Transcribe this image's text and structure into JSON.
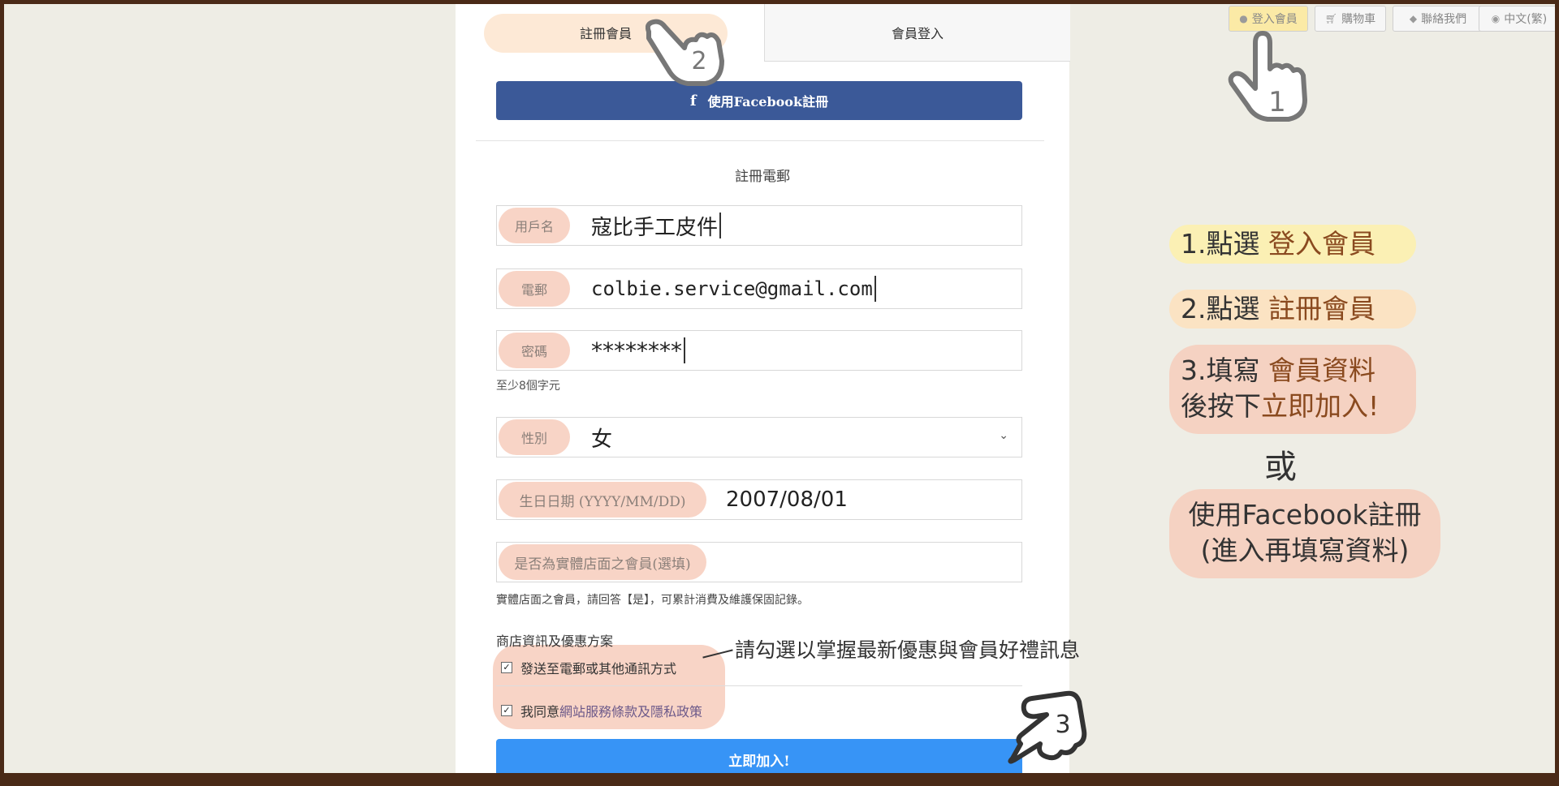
{
  "tabs": {
    "register": "註冊會員",
    "login": "會員登入"
  },
  "facebook": {
    "icon": "f",
    "label": "使用Facebook註冊"
  },
  "section_title": "註冊電郵",
  "fields": {
    "username": {
      "label": "用戶名",
      "value": "寇比手工皮件"
    },
    "email": {
      "label": "電郵",
      "value": "colbie.service@gmail.com"
    },
    "password": {
      "label": "密碼",
      "value": "********",
      "hint": "至少8個字元"
    },
    "gender": {
      "label": "性別",
      "value": "女"
    },
    "birthday": {
      "label": "生日日期 (YYYY/MM/DD)",
      "value": "2007/08/01"
    },
    "store_member": {
      "label": "是否為實體店面之會員(選填)",
      "hint": "實體店面之會員，請回答【是】，可累計消費及維護保固記錄。"
    }
  },
  "preferences": {
    "title": "商店資訊及優惠方案",
    "option_1": "發送至電郵或其他通訊方式",
    "option_2_prefix": "我同意",
    "option_2_link": "網站服務條款及隱私政策",
    "checked_mark": "✓"
  },
  "submit_label": "立即加入!",
  "annotation": "請勾選以掌握最新優惠與會員好禮訊息",
  "nav": {
    "login": "登入會員",
    "cart": "購物車",
    "contact": "聯絡我們",
    "language": "中文(繁)",
    "icons": [
      "user-icon",
      "cart-icon",
      "chat-icon",
      "globe-icon"
    ]
  },
  "steps": {
    "s1_prefix": "1.點選 ",
    "s1_accent": "登入會員",
    "s2_prefix": "2.點選 ",
    "s2_accent": "註冊會員",
    "s3_line1_prefix": "3.填寫 ",
    "s3_line1_accent": "會員資料",
    "s3_line2_prefix": "後按下",
    "s3_line2_accent": "立即加入!",
    "or": "或",
    "s4_line1": "使用Facebook註冊",
    "s4_line2": "(進入再填寫資料)"
  },
  "hand_numbers": [
    "1",
    "2",
    "3"
  ],
  "colors": {
    "facebook_blue": "#3b5998",
    "submit_blue": "#3794f6",
    "label_highlight": "#f8d4c6",
    "frame_brown": "#4a2a17",
    "accent_brown": "#8a4a1f"
  }
}
